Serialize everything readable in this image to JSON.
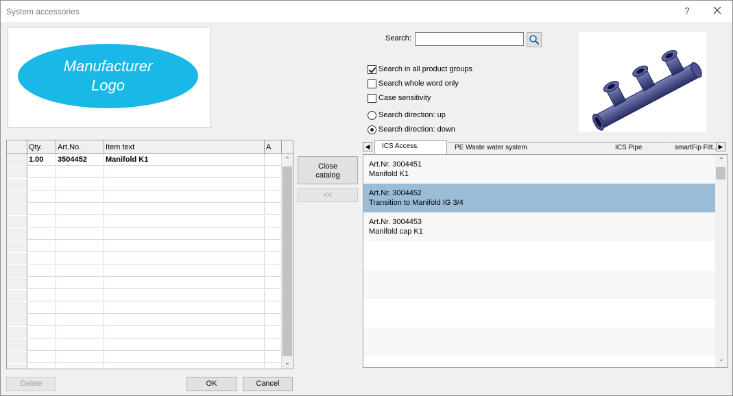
{
  "window": {
    "title": "System accessories",
    "help_label": "?",
    "close_label": "×"
  },
  "logo": {
    "line1": "Manufacturer",
    "line2": "Logo",
    "color": "#19b8e6"
  },
  "grid": {
    "columns": [
      "Qty.",
      "Art.No.",
      "Item text",
      "A"
    ],
    "rows": [
      {
        "qty": "1.00",
        "art_no": "3504452",
        "item_text": "Manifold K1",
        "a": ""
      }
    ],
    "empty_rows": 17
  },
  "middle": {
    "close_catalog_line1": "Close",
    "close_catalog_line2": "catalog",
    "back_label": "<<"
  },
  "search": {
    "label": "Search:",
    "value": "",
    "placeholder": "",
    "button_icon": "magnifier-icon",
    "options": [
      {
        "type": "checkbox",
        "label": "Search in all product groups",
        "checked": true
      },
      {
        "type": "checkbox",
        "label": "Search whole word only",
        "checked": false
      },
      {
        "type": "checkbox",
        "label": "Case sensitivity",
        "checked": false
      },
      {
        "type": "radio",
        "label": "Search direction: up",
        "checked": false
      },
      {
        "type": "radio",
        "label": "Search direction: down",
        "checked": true
      }
    ]
  },
  "tabs": [
    {
      "label": "ICS Access.",
      "active": true
    },
    {
      "label": "PE Waste water system",
      "active": false
    },
    {
      "label": "ICS Pipe",
      "active": false
    },
    {
      "label": "smartFip Fitt...",
      "active": false
    }
  ],
  "catalog": {
    "items": [
      {
        "art": "Art.Nr. 3004451",
        "text": "Manifold K1",
        "selected": false
      },
      {
        "art": "Art.Nr. 3004452",
        "text": "Transition to Manifold IG 3/4",
        "selected": true
      },
      {
        "art": "Art.Nr. 3004453",
        "text": "Manifold cap K1",
        "selected": false
      }
    ],
    "selected_color": "#9bbcd7"
  },
  "footer": {
    "delete_label": "Delete",
    "ok_label": "OK",
    "cancel_label": "Cancel"
  }
}
